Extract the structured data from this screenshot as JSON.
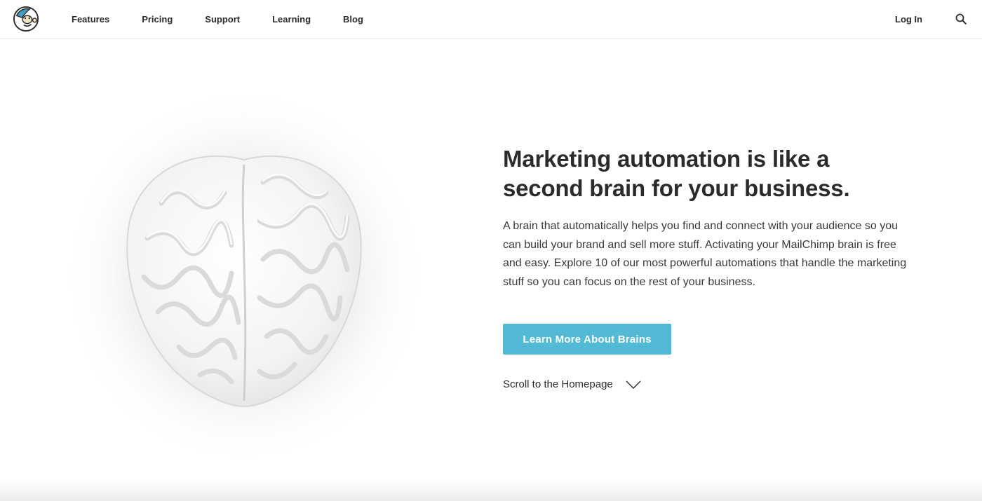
{
  "header": {
    "logo_icon": "mailchimp-freddie-icon",
    "nav": [
      {
        "label": "Features"
      },
      {
        "label": "Pricing"
      },
      {
        "label": "Support"
      },
      {
        "label": "Learning"
      },
      {
        "label": "Blog"
      }
    ],
    "login_label": "Log In",
    "search_icon": "search-icon"
  },
  "hero": {
    "image": "brain-illustration",
    "headline_line1": "Marketing automation is like a",
    "headline_line2": "second brain for your business.",
    "body": "A brain that automatically helps you find and connect with your audience so you can build your brand and sell more stuff. Activating your MailChimp brain is free and easy. Explore 10 of our most powerful automations that handle the marketing stuff so you can focus on the rest of your business.",
    "cta_label": "Learn More About Brains",
    "scroll_label": "Scroll to the Homepage",
    "scroll_icon": "chevron-down-icon"
  },
  "colors": {
    "accent": "#52bad5",
    "text": "#2b2b2b"
  }
}
